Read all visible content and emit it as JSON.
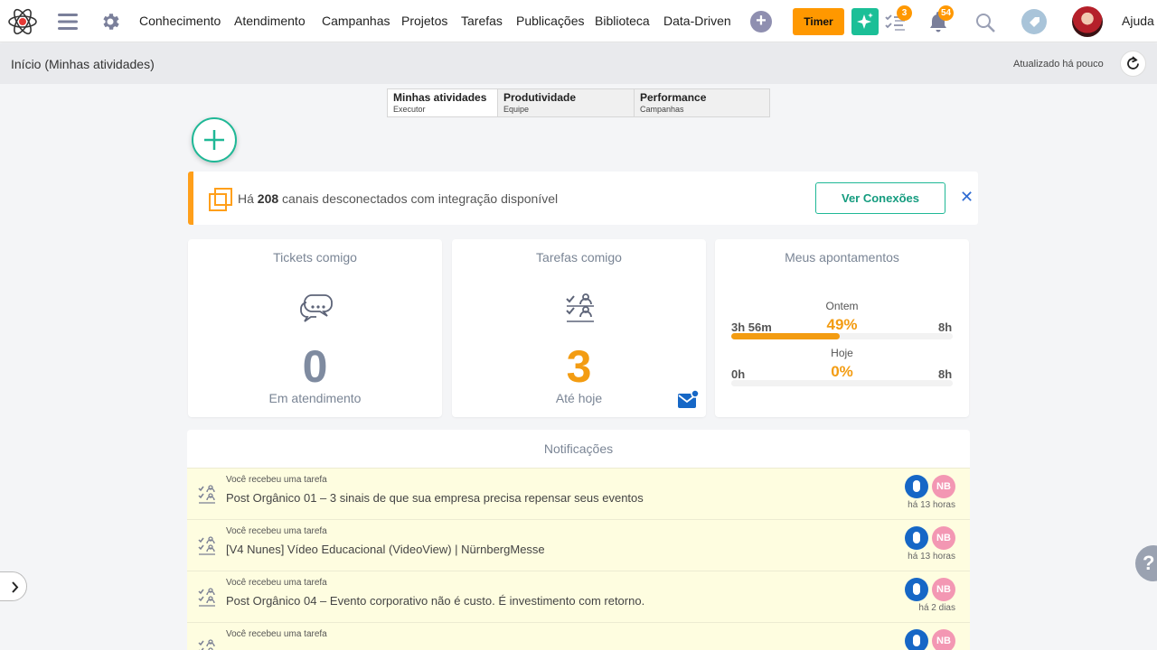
{
  "nav": {
    "links": [
      "Conhecimento",
      "Atendimento",
      "Campanhas",
      "Projetos",
      "Tarefas",
      "Publicações",
      "Biblioteca",
      "Data-Driven"
    ],
    "timer_label": "Timer",
    "tasks_badge": "3",
    "notifications_badge": "54",
    "help_label": "Ajuda"
  },
  "subheader": {
    "breadcrumb": "Início (Minhas atividades)",
    "updated": "Atualizado há pouco"
  },
  "tabs": [
    {
      "title": "Minhas atividades",
      "subtitle": "Executor"
    },
    {
      "title": "Produtividade",
      "subtitle": "Equipe"
    },
    {
      "title": "Performance",
      "subtitle": "Campanhas"
    }
  ],
  "alert": {
    "prefix": "Há ",
    "count": "208",
    "suffix": " canais desconectados com integração disponível",
    "button": "Ver Conexões",
    "close": "✕"
  },
  "cards": {
    "tickets": {
      "title": "Tickets comigo",
      "value": "0",
      "subtitle": "Em atendimento"
    },
    "tarefas": {
      "title": "Tarefas comigo",
      "value": "3",
      "subtitle": "Até hoje"
    },
    "apontamentos": {
      "title": "Meus apontamentos",
      "ontem": {
        "label": "Ontem",
        "pct": "49%",
        "left": "3h 56m",
        "right": "8h",
        "fraction": 0.49
      },
      "hoje": {
        "label": "Hoje",
        "pct": "0%",
        "left": "0h",
        "right": "8h",
        "fraction": 0
      }
    }
  },
  "notifications": {
    "title": "Notificações",
    "items": [
      {
        "kind": "Você recebeu uma tarefa",
        "text": "Post Orgânico 01 – 3 sinais de que sua empresa precisa repensar seus eventos",
        "initials": "NB",
        "time": "há 13 horas"
      },
      {
        "kind": "Você recebeu uma tarefa",
        "text": "[V4 Nunes] Vídeo Educacional (VideoView) | NürnbergMesse",
        "initials": "NB",
        "time": "há 13 horas"
      },
      {
        "kind": "Você recebeu uma tarefa",
        "text": "Post Orgânico 04 – Evento corporativo não é custo. É investimento com retorno.",
        "initials": "NB",
        "time": "há 2 dias"
      },
      {
        "kind": "Você recebeu uma tarefa",
        "text": "",
        "initials": "NB",
        "time": ""
      }
    ]
  },
  "colors": {
    "accent": "#1fb896",
    "orange": "#ff9800",
    "number_gray": "#7f8ba0",
    "number_orange": "#f39c12"
  },
  "help_fab": "?"
}
